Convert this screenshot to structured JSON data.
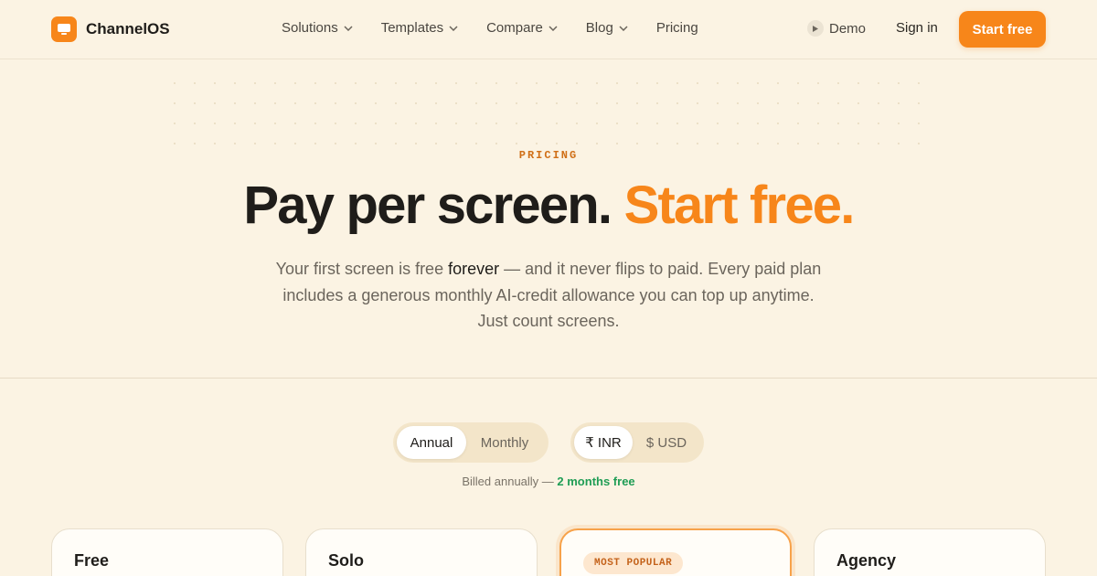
{
  "brand": {
    "name": "ChannelOS",
    "icon": "monitor-icon",
    "accent": "#f7861a"
  },
  "nav": {
    "items": [
      {
        "label": "Solutions",
        "has_dropdown": true
      },
      {
        "label": "Templates",
        "has_dropdown": true
      },
      {
        "label": "Compare",
        "has_dropdown": true
      },
      {
        "label": "Blog",
        "has_dropdown": true
      },
      {
        "label": "Pricing",
        "has_dropdown": false
      }
    ],
    "demo_label": "Demo",
    "signin_label": "Sign in",
    "cta_label": "Start free"
  },
  "hero": {
    "eyebrow": "PRICING",
    "headline_main": "Pay per screen.",
    "headline_accent": "Start free.",
    "sub_before": "Your first screen is free ",
    "sub_emphasis": "forever",
    "sub_after": " — and it never flips to paid. Every paid plan includes a generous monthly AI-credit allowance you can top up anytime. Just count screens."
  },
  "billing_toggle": {
    "options": [
      "Annual",
      "Monthly"
    ],
    "selected": "Annual"
  },
  "currency_toggle": {
    "options": [
      "₹ INR",
      "$ USD"
    ],
    "selected": "₹ INR"
  },
  "billed_note": {
    "text": "Billed annually — ",
    "highlight": "2 months free",
    "highlight_color": "#1f9d55"
  },
  "plans": [
    {
      "name": "Free"
    },
    {
      "name": "Solo"
    },
    {
      "name": "",
      "badge": "MOST POPULAR"
    },
    {
      "name": "Agency"
    }
  ]
}
